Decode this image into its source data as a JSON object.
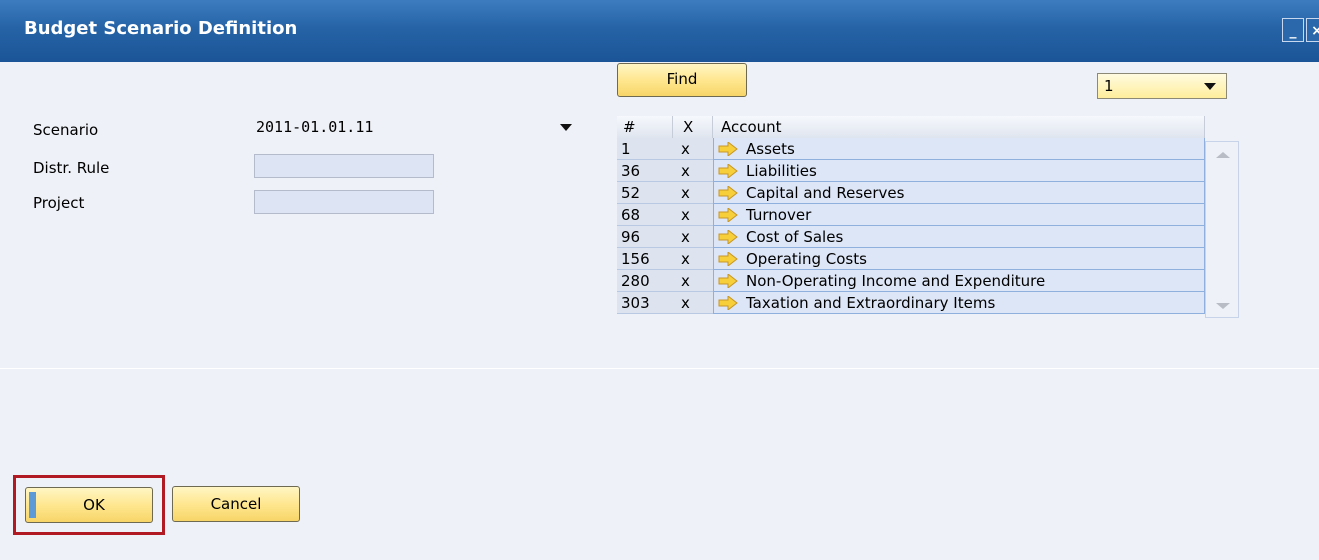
{
  "window": {
    "title": "Budget Scenario Definition"
  },
  "form": {
    "scenario_label": "Scenario",
    "scenario_value": "2011-01.01.11",
    "distr_rule_label": "Distr. Rule",
    "distr_rule_value": "",
    "project_label": "Project",
    "project_value": ""
  },
  "toolbar": {
    "find_label": "Find",
    "page_value": "1"
  },
  "grid": {
    "headers": [
      "#",
      "X",
      "Account"
    ],
    "rows": [
      {
        "num": "1",
        "x": "x",
        "account": "Assets"
      },
      {
        "num": "36",
        "x": "x",
        "account": "Liabilities"
      },
      {
        "num": "52",
        "x": "x",
        "account": "Capital and Reserves"
      },
      {
        "num": "68",
        "x": "x",
        "account": "Turnover"
      },
      {
        "num": "96",
        "x": "x",
        "account": "Cost of Sales"
      },
      {
        "num": "156",
        "x": "x",
        "account": "Operating Costs"
      },
      {
        "num": "280",
        "x": "x",
        "account": "Non-Operating Income and Expenditure"
      },
      {
        "num": "303",
        "x": "x",
        "account": "Taxation and Extraordinary Items"
      }
    ],
    "row_icon": "yellow-arrow-icon"
  },
  "buttons": {
    "ok_label": "OK",
    "cancel_label": "Cancel"
  },
  "colors": {
    "title_bar": "#2563a6",
    "button_yellow": "#ffe790",
    "highlight": "#b11a22"
  }
}
